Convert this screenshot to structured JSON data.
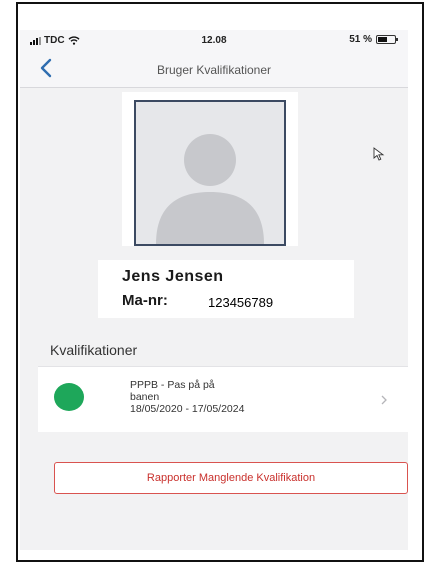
{
  "status_bar": {
    "carrier": "TDC",
    "time": "12.08",
    "battery_percent": "51 %",
    "battery_level": 0.51
  },
  "nav": {
    "title": "Bruger Kvalifikationer",
    "back_icon": "chevron-left-icon"
  },
  "profile": {
    "name": "Jens Jensen",
    "manr_label": "Ma-nr:",
    "manr_value": "123456789",
    "avatar_icon": "person-silhouette-icon"
  },
  "qualifications": {
    "section_title": "Kvalifikationer",
    "items": [
      {
        "title_line1": "PPPB - Pas på på",
        "title_line2": "banen",
        "validity": "18/05/2020 - 17/05/2024",
        "status_color": "#1ea75a"
      }
    ]
  },
  "actions": {
    "report_label": "Rapporter Manglende Kvalifikation"
  },
  "colors": {
    "accent": "#2f6db0",
    "danger": "#d9534f",
    "status_ok": "#1ea75a"
  }
}
